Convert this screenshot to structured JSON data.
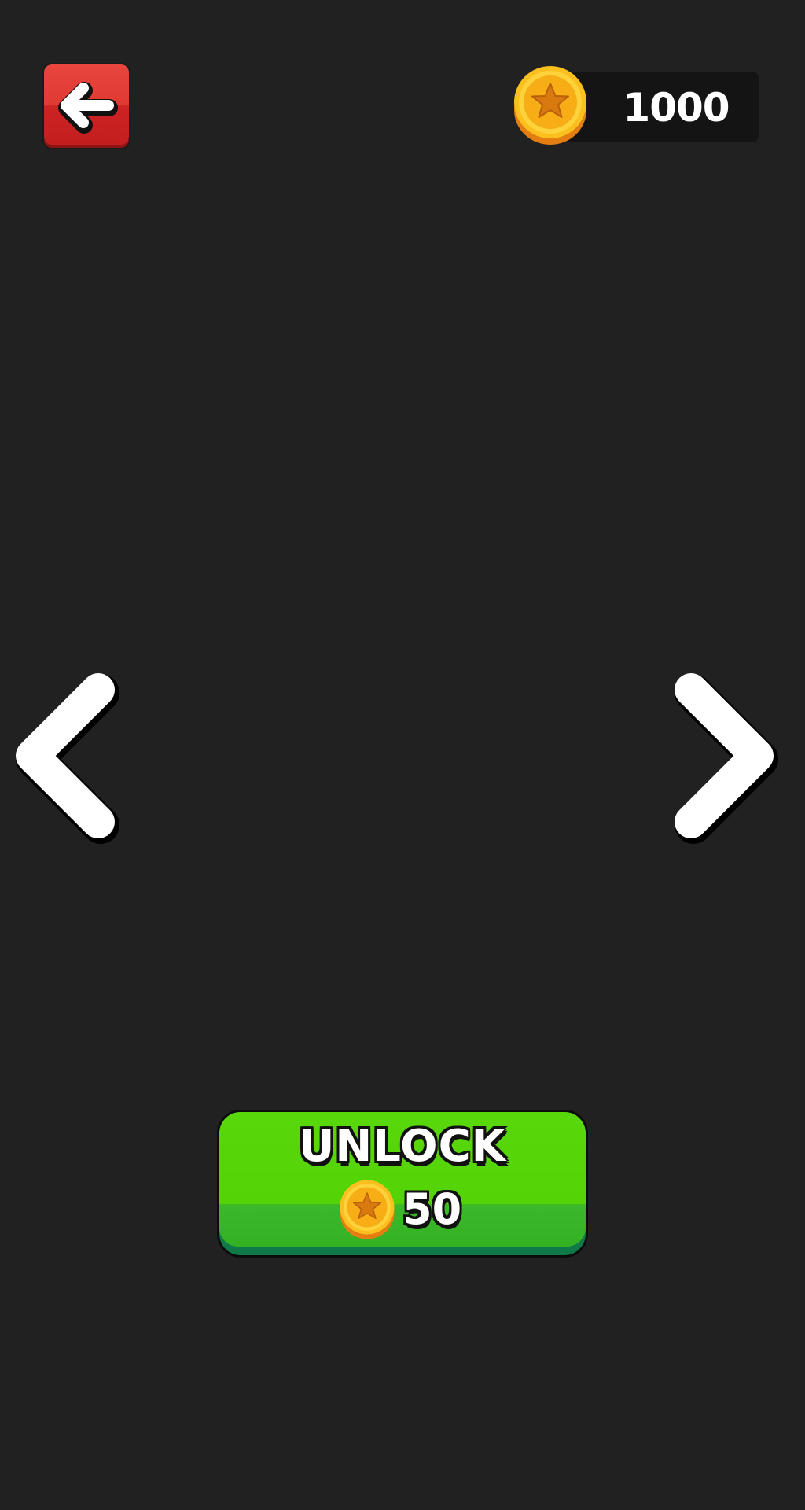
{
  "header": {
    "coin_balance": "1000"
  },
  "unlock_button": {
    "label": "UNLOCK",
    "price": "50"
  },
  "icons": {
    "back": "back-arrow-icon",
    "coin": "star-coin-icon",
    "previous": "chevron-left-icon",
    "next": "chevron-right-icon"
  },
  "colors": {
    "background": "#212121",
    "back_button": "#e03a33",
    "unlock_button": "#54d406",
    "coin": "#fbbf1e",
    "coin_star": "#e58a12",
    "panel": "#141414",
    "text": "#ffffff"
  }
}
